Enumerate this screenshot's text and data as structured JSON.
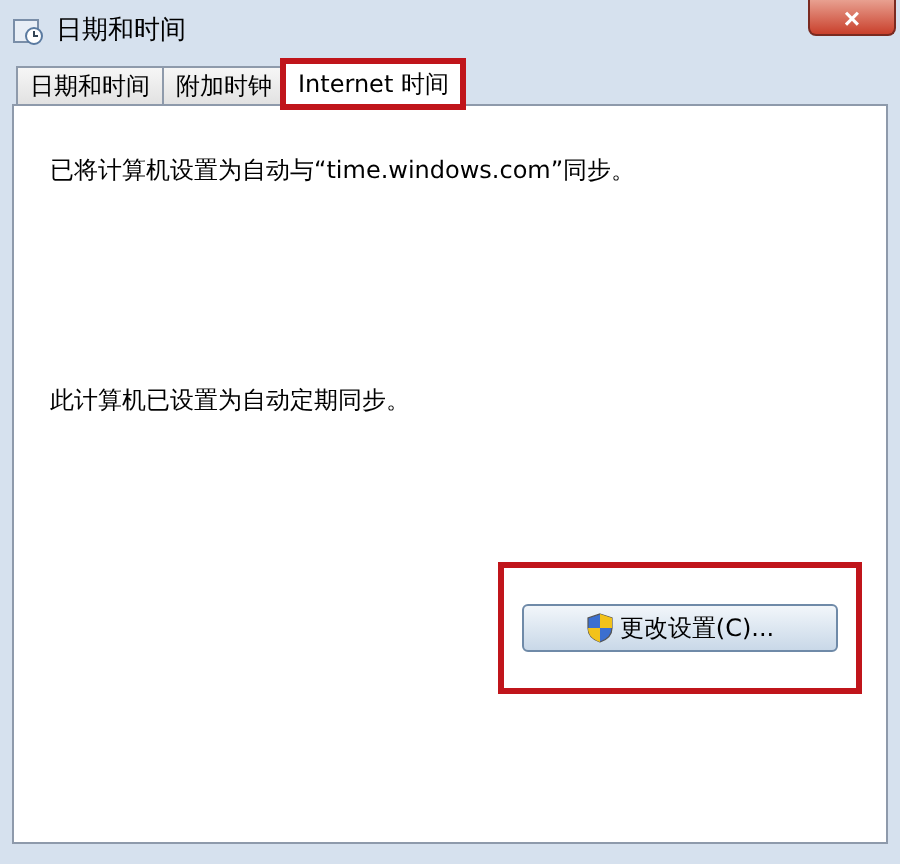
{
  "window": {
    "title": "日期和时间",
    "close_label": "×"
  },
  "tabs": [
    {
      "label": "日期和时间",
      "selected": false,
      "highlighted": false
    },
    {
      "label": "附加时钟",
      "selected": false,
      "highlighted": false
    },
    {
      "label": "Internet 时间",
      "selected": true,
      "highlighted": true
    }
  ],
  "messages": [
    "已将计算机设置为自动与“time.windows.com”同步。",
    "此计算机已设置为自动定期同步。"
  ],
  "button": {
    "label": "更改设置(C)...",
    "shield": true,
    "highlighted": true
  }
}
